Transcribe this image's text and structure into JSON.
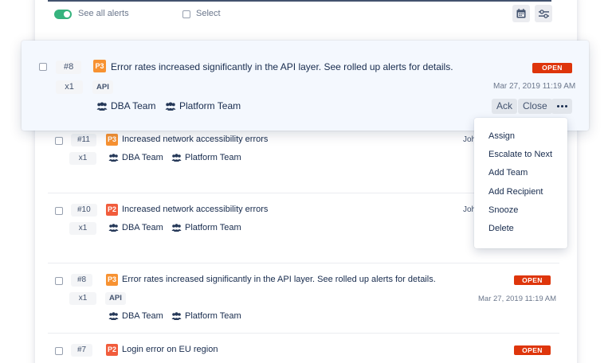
{
  "toolbar": {
    "see_all_alerts": "See all alerts",
    "select": "Select",
    "calendar_icon": "calendar-icon",
    "filter_icon": "sliders-icon"
  },
  "focused_alert": {
    "id": "#8",
    "count": "x1",
    "priority": "P3",
    "message": "Error rates increased significantly in the API layer. See rolled up alerts for details.",
    "tag": "API",
    "teams": [
      "DBA Team",
      "Platform Team"
    ],
    "status": "OPEN",
    "timestamp": "Mar 27, 2019 11:19 AM",
    "actions": {
      "ack": "Ack",
      "close": "Close"
    }
  },
  "menu": {
    "items": [
      "Assign",
      "Escalate to Next",
      "Add Team",
      "Add Recipient",
      "Snooze",
      "Delete"
    ]
  },
  "alerts": [
    {
      "id": "#11",
      "count": "x1",
      "priority": "P3",
      "message": "Increased network accessibility errors",
      "teams": [
        "DBA Team",
        "Platform Team"
      ],
      "owner": "Joh"
    },
    {
      "id": "#10",
      "count": "x1",
      "priority": "P2",
      "message": "Increased network accessibility errors",
      "teams": [
        "DBA Team",
        "Platform Team"
      ],
      "owner": "Joh"
    },
    {
      "id": "#8",
      "count": "x1",
      "priority": "P3",
      "message": "Error rates increased significantly in the API layer. See rolled up alerts for details.",
      "tag": "API",
      "teams": [
        "DBA Team",
        "Platform Team"
      ],
      "status": "OPEN",
      "timestamp": "Mar 27, 2019 11:19 AM"
    },
    {
      "id": "#7",
      "priority": "P2",
      "message": "Login error on EU region",
      "status": "OPEN"
    }
  ],
  "colors": {
    "p3": "#f79232",
    "p2": "#f15c3c",
    "open": "#de350b",
    "toggle_on": "#36b37e"
  }
}
